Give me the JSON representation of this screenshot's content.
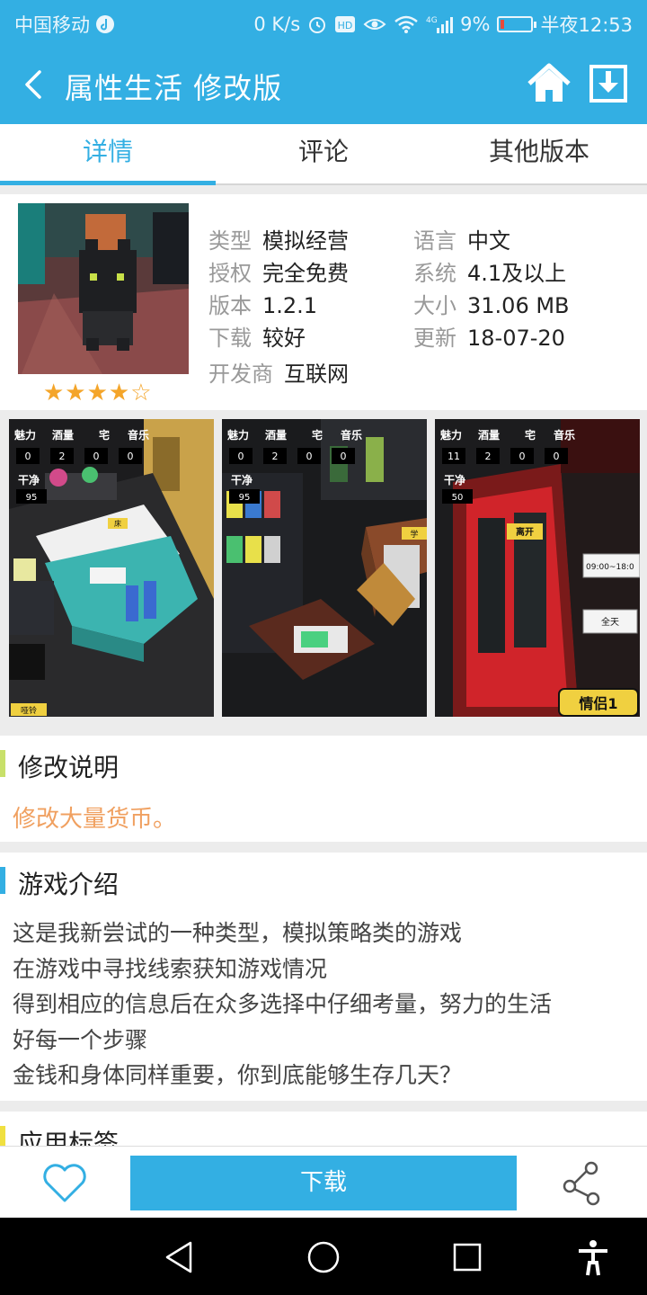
{
  "status_bar": {
    "carrier": "中国移动",
    "speed": "0 K/s",
    "battery": "9%",
    "time": "半夜12:53",
    "network": "4G"
  },
  "header": {
    "title": "属性生活 修改版",
    "icons": [
      "back-icon",
      "home-icon",
      "download-icon"
    ]
  },
  "tabs": [
    {
      "label": "详情",
      "active": true
    },
    {
      "label": "评论",
      "active": false
    },
    {
      "label": "其他版本",
      "active": false
    }
  ],
  "app_info": {
    "rating_stars": "★★★★☆",
    "rating": 4,
    "rating_max": 5,
    "type_label": "类型",
    "type_value": "模拟经营",
    "lang_label": "语言",
    "lang_value": "中文",
    "license_label": "授权",
    "license_value": "完全免费",
    "system_label": "系统",
    "system_value": "4.1及以上",
    "version_label": "版本",
    "version_value": "1.2.1",
    "size_label": "大小",
    "size_value": "31.06 MB",
    "download_label": "下载",
    "download_value": "较好",
    "update_label": "更新",
    "update_value": "18-07-20",
    "developer_label": "开发商",
    "developer_value": "互联网"
  },
  "screenshots": [
    {
      "hud": [
        "魅力",
        "酒量",
        "宅",
        "音乐"
      ],
      "values": [
        "0",
        "2",
        "0",
        "0"
      ],
      "clean_label": "干净",
      "clean_value": "95",
      "corner": "哑铃",
      "tag": "床"
    },
    {
      "hud": [
        "魅力",
        "酒量",
        "宅",
        "音乐"
      ],
      "values": [
        "0",
        "2",
        "0",
        "0"
      ],
      "clean_label": "干净",
      "clean_value": "95",
      "tag": "学"
    },
    {
      "hud": [
        "魅力",
        "酒量",
        "宅",
        "音乐"
      ],
      "values": [
        "11",
        "2",
        "0",
        "0"
      ],
      "clean_label": "干净",
      "clean_value": "50",
      "leave": "离开",
      "hours": "09:00~18:0",
      "allday": "全天",
      "badge": "情侣1"
    }
  ],
  "mod_section": {
    "title": "修改说明",
    "text": "修改大量货币。",
    "accent": "#c8e06a"
  },
  "intro_section": {
    "title": "游戏介绍",
    "lines": [
      "这是我新尝试的一种类型，模拟策略类的游戏",
      "在游戏中寻找线索获知游戏情况",
      "得到相应的信息后在众多选择中仔细考量，努力的生活",
      "好每一个步骤",
      "金钱和身体同样重要，你到底能够生存几天？"
    ],
    "accent": "#33afe3"
  },
  "tags_section": {
    "title": "应用标签",
    "accent": "#f0e040"
  },
  "actions": {
    "download_label": "下载",
    "fav_icon": "heart-icon",
    "share_icon": "share-icon"
  },
  "colors": {
    "primary": "#33afe3",
    "star": "#f4a52a",
    "mod_text": "#f0a060"
  }
}
